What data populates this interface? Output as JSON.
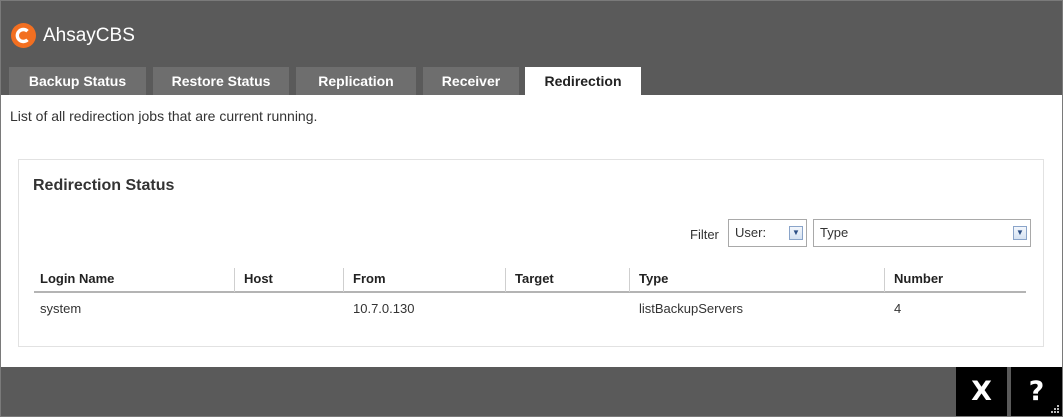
{
  "app": {
    "title": "AhsayCBS",
    "accent": "#f26f21"
  },
  "tabs": [
    {
      "label": "Backup Status",
      "active": false
    },
    {
      "label": "Restore Status",
      "active": false
    },
    {
      "label": "Replication",
      "active": false
    },
    {
      "label": "Receiver",
      "active": false
    },
    {
      "label": "Redirection",
      "active": true
    }
  ],
  "main": {
    "description": "List of all redirection jobs that are current running.",
    "panel_title": "Redirection Status",
    "filter": {
      "label": "Filter",
      "user_select": "User:",
      "type_select": "Type"
    },
    "columns": [
      "Login Name",
      "Host",
      "From",
      "Target",
      "Type",
      "Number"
    ],
    "rows": [
      {
        "login_name": "system",
        "host": "",
        "from": "10.7.0.130",
        "target": "",
        "type": "listBackupServers",
        "number": "4"
      }
    ]
  },
  "footer": {
    "close_label": "X",
    "help_label": "?"
  }
}
